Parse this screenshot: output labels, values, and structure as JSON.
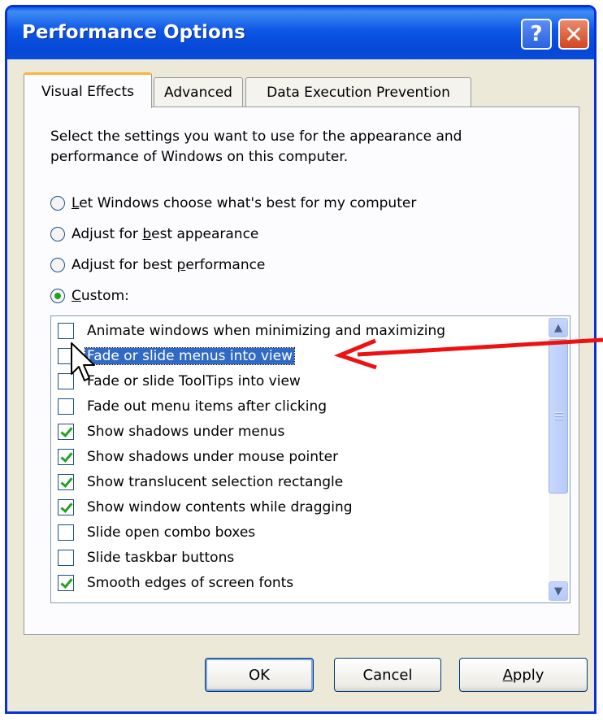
{
  "window": {
    "title": "Performance Options",
    "help_glyph": "?",
    "close_glyph": "✕"
  },
  "tabs": [
    {
      "label": "Visual Effects",
      "selected": true
    },
    {
      "label": "Advanced",
      "selected": false
    },
    {
      "label": "Data Execution Prevention",
      "selected": false
    }
  ],
  "intro_text": "Select the settings you want to use for the appearance and performance of Windows on this computer.",
  "radios": [
    {
      "pre": "",
      "key": "L",
      "post": "et Windows choose what's best for my computer",
      "checked": false
    },
    {
      "pre": "Adjust for ",
      "key": "b",
      "post": "est appearance",
      "checked": false
    },
    {
      "pre": "Adjust for best ",
      "key": "p",
      "post": "erformance",
      "checked": false
    },
    {
      "pre": "",
      "key": "C",
      "post": "ustom:",
      "checked": true
    }
  ],
  "effects": [
    {
      "label": "Animate windows when minimizing and maximizing",
      "checked": false,
      "selected": false
    },
    {
      "label": "Fade or slide menus into view",
      "checked": false,
      "selected": true
    },
    {
      "label": "Fade or slide ToolTips into view",
      "checked": false,
      "selected": false
    },
    {
      "label": "Fade out menu items after clicking",
      "checked": false,
      "selected": false
    },
    {
      "label": "Show shadows under menus",
      "checked": true,
      "selected": false
    },
    {
      "label": "Show shadows under mouse pointer",
      "checked": true,
      "selected": false
    },
    {
      "label": "Show translucent selection rectangle",
      "checked": true,
      "selected": false
    },
    {
      "label": "Show window contents while dragging",
      "checked": true,
      "selected": false
    },
    {
      "label": "Slide open combo boxes",
      "checked": false,
      "selected": false
    },
    {
      "label": "Slide taskbar buttons",
      "checked": false,
      "selected": false
    },
    {
      "label": "Smooth edges of screen fonts",
      "checked": true,
      "selected": false
    }
  ],
  "scroll_up_glyph": "▲",
  "scroll_down_glyph": "▼",
  "buttons": {
    "ok": "OK",
    "cancel": "Cancel",
    "apply_key": "A",
    "apply_rest": "pply"
  },
  "colors": {
    "titlebar": "#0a4cda",
    "selection": "#316ac5",
    "annotation_arrow": "#ee1111",
    "checkmark": "#21a121"
  }
}
